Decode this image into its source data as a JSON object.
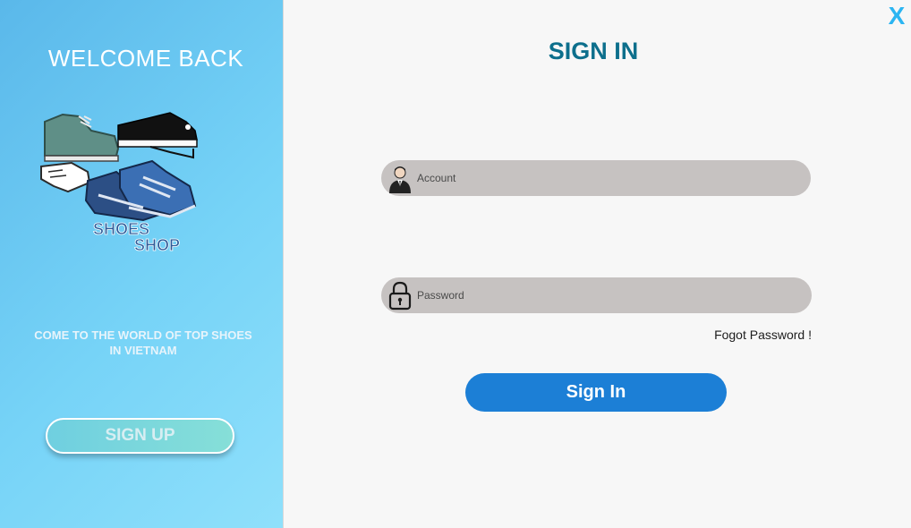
{
  "left_panel": {
    "welcome": "WELCOME BACK",
    "logo_text_line1": "SHOES",
    "logo_text_line2": "SHOP",
    "tagline_line1": "COME TO THE WORLD OF TOP SHOES",
    "tagline_line2": "IN VIETNAM",
    "signup_label": "SIGN UP"
  },
  "main": {
    "close_label": "X",
    "title": "SIGN IN",
    "account_placeholder": "Account",
    "password_placeholder": "Password",
    "forgot_label": "Fogot Password !",
    "signin_label": "Sign In"
  },
  "icons": {
    "close": "close-icon",
    "account": "user-icon",
    "password": "lock-icon",
    "logo": "shoes-logo-icon"
  },
  "colors": {
    "panel_gradient_start": "#5ab8ea",
    "panel_gradient_end": "#8fe0fb",
    "title": "#0d6f8c",
    "close": "#2bb5f2",
    "field_bg": "#c6c2c1",
    "primary_button": "#1c7fd6",
    "signup_button": "#6fcfe0"
  }
}
